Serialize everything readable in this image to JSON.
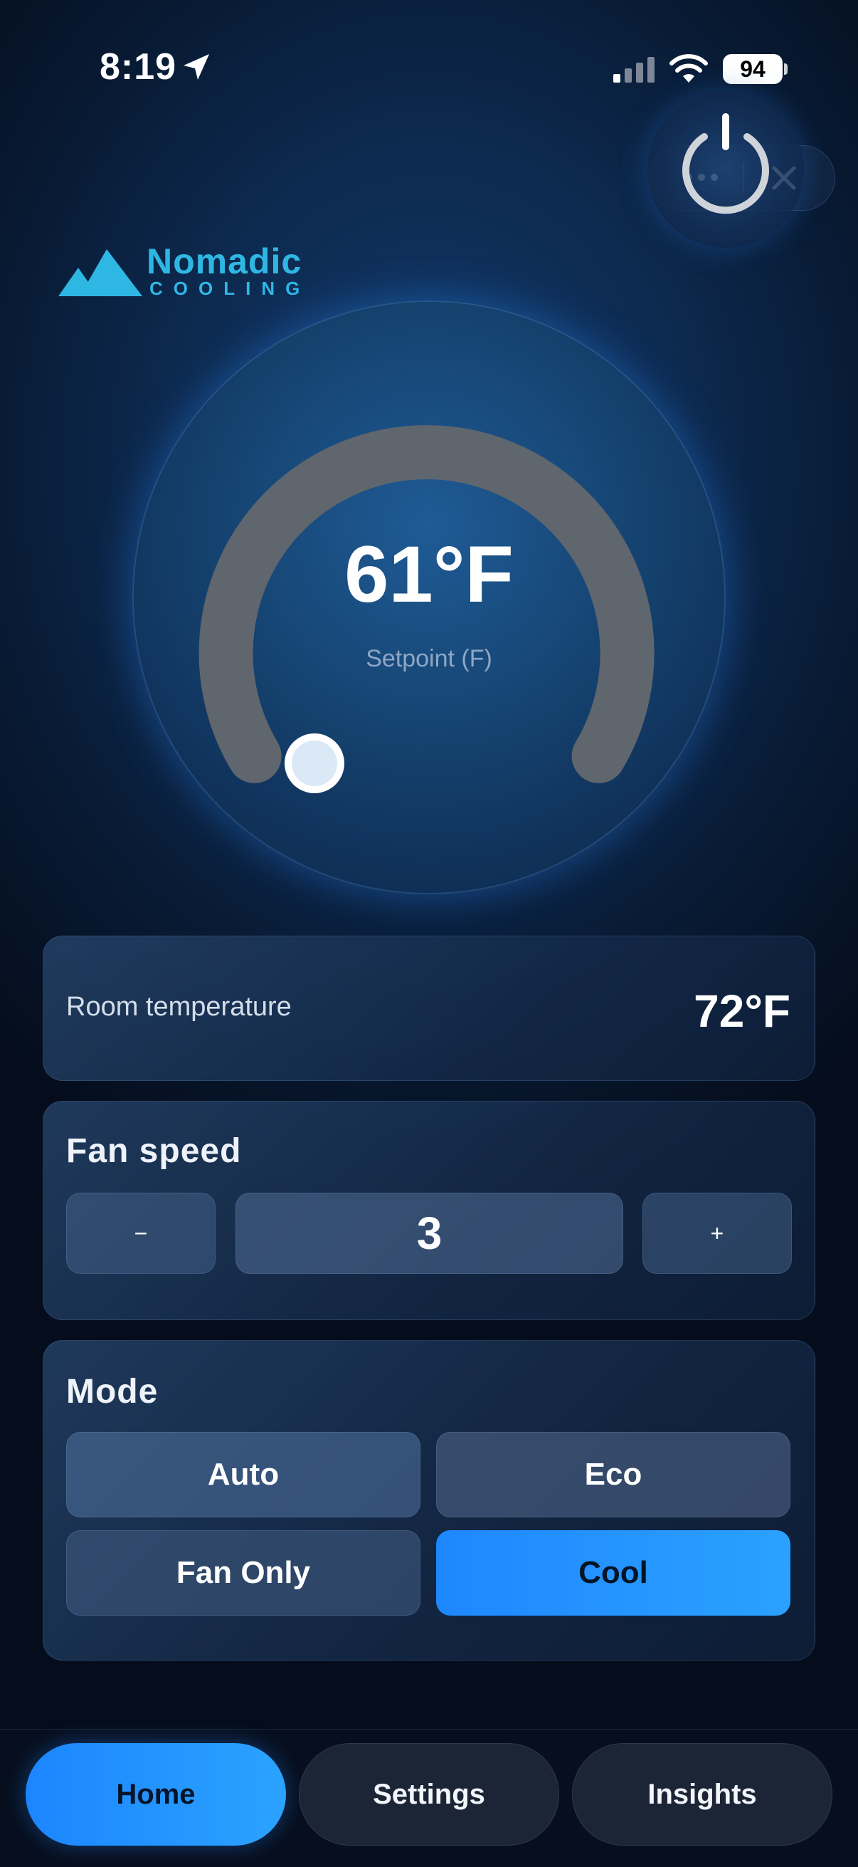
{
  "status_bar": {
    "time": "8:19",
    "battery": "94"
  },
  "logo": {
    "title": "Nomadic",
    "subtitle": "COOLING"
  },
  "dial": {
    "value": "61°F",
    "label": "Setpoint (F)"
  },
  "room": {
    "label": "Room temperature",
    "value": "72°F"
  },
  "fan": {
    "title": "Fan speed",
    "minus": "−",
    "value": "3",
    "plus": "+"
  },
  "mode": {
    "title": "Mode",
    "options": [
      "Auto",
      "Eco",
      "Fan Only",
      "Cool"
    ],
    "selected": "Cool"
  },
  "nav": {
    "items": [
      "Home",
      "Settings",
      "Insights"
    ],
    "active": "Home"
  },
  "colors": {
    "accent": "#1e8cff",
    "logo": "#2fb7e4",
    "arc": "#5f666d"
  }
}
